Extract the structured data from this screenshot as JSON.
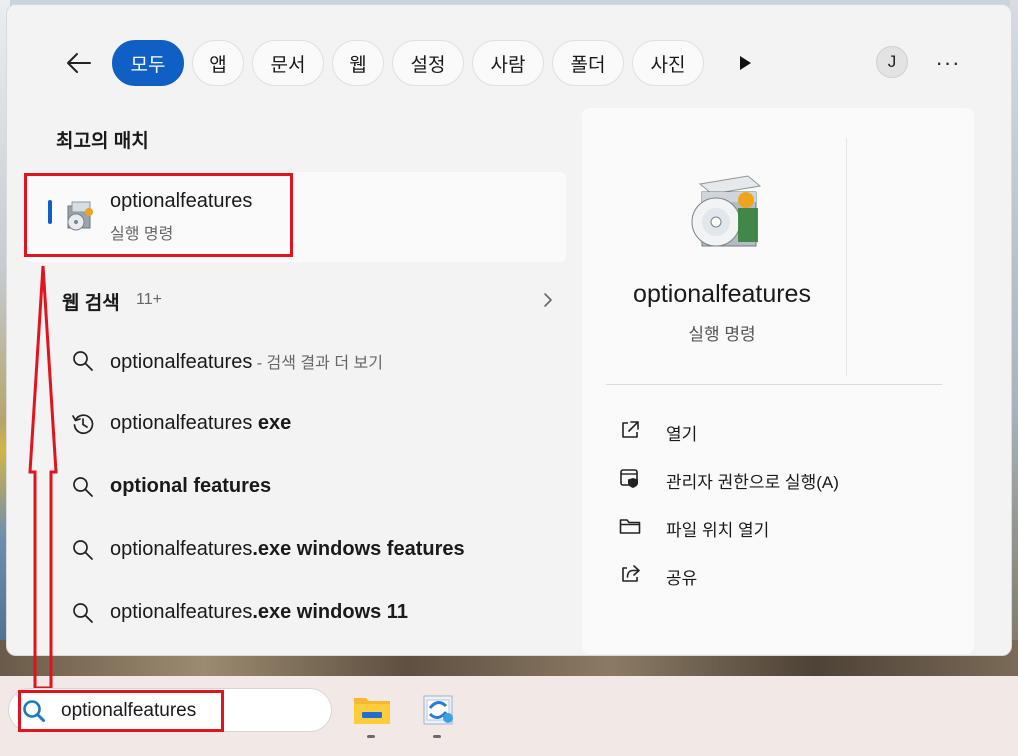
{
  "nav": {
    "tabs": [
      "모두",
      "앱",
      "문서",
      "웹",
      "설정",
      "사람",
      "폴더",
      "사진"
    ],
    "active_tab": "모두",
    "avatar_initial": "J",
    "more_label": "···"
  },
  "best_match": {
    "section_title": "최고의 매치",
    "name": "optionalfeatures",
    "type": "실행 명령"
  },
  "web_search": {
    "title": "웹 검색",
    "count": "11+",
    "suggestions": [
      {
        "icon": "search-icon",
        "plain": "optionalfeatures",
        "bold": "",
        "hint": " - 검색 결과 더 보기"
      },
      {
        "icon": "history-icon",
        "plain": "optionalfeatures",
        "bold": " exe",
        "hint": ""
      },
      {
        "icon": "search-icon",
        "plain": "",
        "bold": "optional features",
        "hint": ""
      },
      {
        "icon": "search-icon",
        "plain": "optionalfeatures",
        "bold": ".exe windows features",
        "hint": ""
      },
      {
        "icon": "search-icon",
        "plain": "optionalfeatures",
        "bold": ".exe windows 11",
        "hint": ""
      }
    ]
  },
  "detail": {
    "name": "optionalfeatures",
    "type": "실행 명령",
    "actions": [
      {
        "icon": "open-external-icon",
        "label": "열기"
      },
      {
        "icon": "admin-shield-icon",
        "label": "관리자 권한으로 실행(A)"
      },
      {
        "icon": "folder-icon",
        "label": "파일 위치 열기"
      },
      {
        "icon": "share-icon",
        "label": "공유"
      }
    ]
  },
  "taskbar": {
    "search_value": "optionalfeatures"
  },
  "colors": {
    "accent": "#0f5fc4",
    "annotation_red": "#e0141e"
  }
}
